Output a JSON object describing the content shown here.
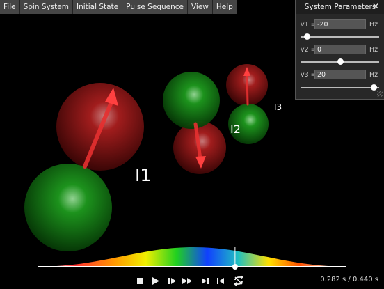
{
  "menu": [
    "File",
    "Spin System",
    "Initial State",
    "Pulse Sequence",
    "View",
    "Help"
  ],
  "spins": {
    "labels": [
      "I1",
      "I2",
      "I3"
    ]
  },
  "panel": {
    "title": "System Parameters",
    "close_glyph": "✕",
    "params": [
      {
        "name": "v1 =",
        "value": "-20",
        "unit": "Hz",
        "slider_fraction": 0.07
      },
      {
        "name": "v2 =",
        "value": "0",
        "unit": "Hz",
        "slider_fraction": 0.5
      },
      {
        "name": "v3 =",
        "value": "20",
        "unit": "Hz",
        "slider_fraction": 0.93
      }
    ]
  },
  "playback": {
    "position_fraction": 0.64,
    "time_text": "0.282 s / 0.440 s"
  },
  "transport_icons": [
    "stop-icon",
    "play-icon",
    "step-forward-icon",
    "fast-forward-icon",
    "skip-to-end-icon",
    "skip-to-start-icon",
    "loop-icon"
  ],
  "colors": {
    "up_sphere": "#cc1a1a",
    "down_sphere": "#1a9a1a",
    "arrow": "#e02020",
    "panel_bg": "#282828",
    "menu_bg": "#454545"
  }
}
